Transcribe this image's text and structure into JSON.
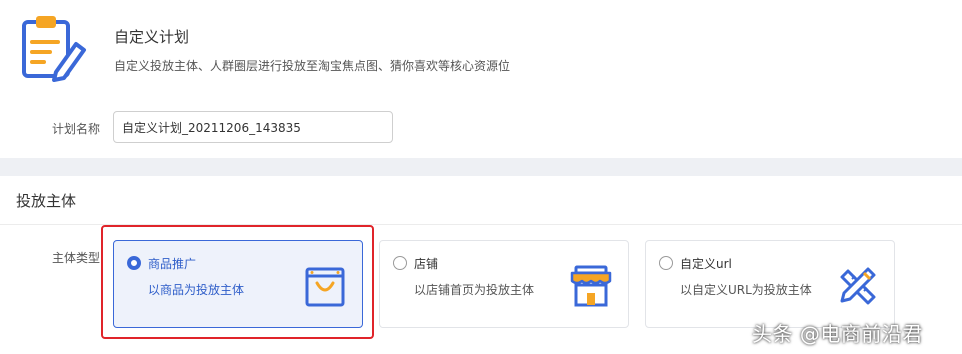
{
  "plan": {
    "title": "自定义计划",
    "description": "自定义投放主体、人群圈层进行投放至淘宝焦点图、猜你喜欢等核心资源位",
    "icon": "clipboard-edit-icon"
  },
  "plan_name": {
    "label": "计划名称",
    "value": "自定义计划_20211206_143835"
  },
  "subject": {
    "section_title": "投放主体",
    "type_label": "主体类型",
    "selected": "商品推广",
    "options": [
      {
        "title": "商品推广",
        "description": "以商品为投放主体",
        "icon": "shopping-bag-icon",
        "selected": true
      },
      {
        "title": "店铺",
        "description": "以店铺首页为投放主体",
        "icon": "storefront-icon",
        "selected": false
      },
      {
        "title": "自定义url",
        "description": "以自定义URL为投放主体",
        "icon": "pencil-ruler-icon",
        "selected": false
      }
    ]
  },
  "watermark": "头条 @电商前沿君",
  "colors": {
    "accent": "#3a68d8",
    "icon_orange": "#f5a524",
    "highlight_red": "#e0242a",
    "selected_bg": "#eef2fb"
  }
}
